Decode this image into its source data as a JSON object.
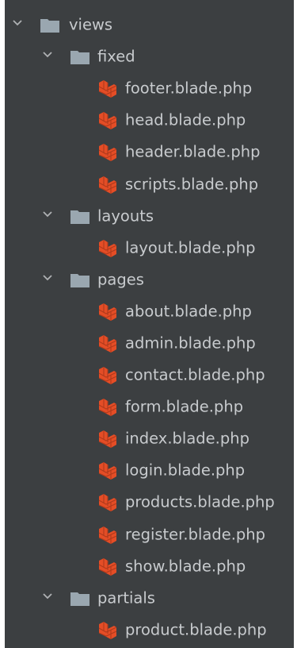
{
  "colors": {
    "background": "#3c3f41",
    "text": "#c8cbce",
    "folder": "#9aa7b0",
    "chevron": "#afb1b3",
    "blade_icon": "#e44d26",
    "blade_icon_lines": "#b03a1c"
  },
  "icons": {
    "chevron": "chevron-down-icon",
    "folder": "folder-icon",
    "file": "blade-file-icon"
  },
  "tree": {
    "root": {
      "label": "views",
      "expanded": true
    },
    "fixed": {
      "label": "fixed",
      "expanded": true,
      "files": [
        "footer.blade.php",
        "head.blade.php",
        "header.blade.php",
        "scripts.blade.php"
      ]
    },
    "layouts": {
      "label": "layouts",
      "expanded": true,
      "files": [
        "layout.blade.php"
      ]
    },
    "pages": {
      "label": "pages",
      "expanded": true,
      "files": [
        "about.blade.php",
        "admin.blade.php",
        "contact.blade.php",
        "form.blade.php",
        "index.blade.php",
        "login.blade.php",
        "products.blade.php",
        "register.blade.php",
        "show.blade.php"
      ]
    },
    "partials": {
      "label": "partials",
      "expanded": true,
      "files": [
        "product.blade.php"
      ]
    }
  }
}
